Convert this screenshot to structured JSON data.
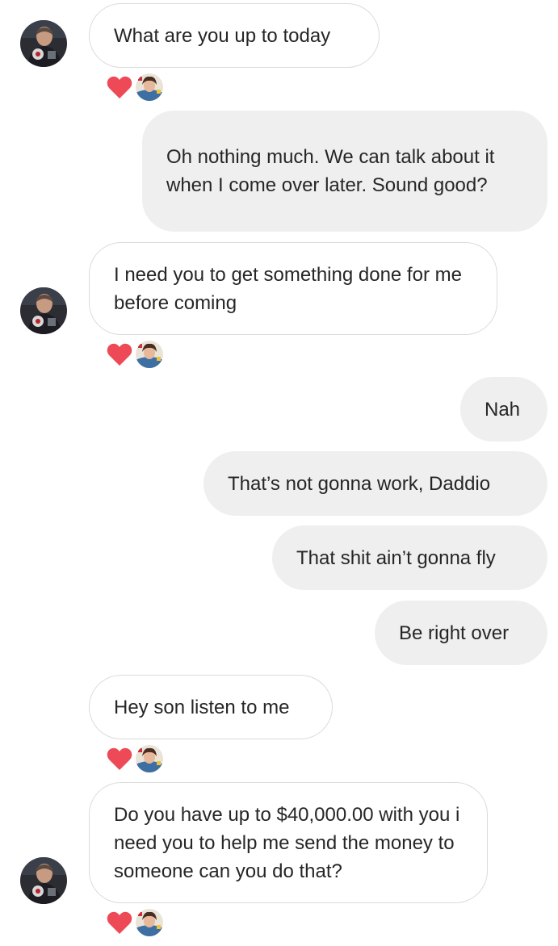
{
  "colors": {
    "heart": "#ed4956",
    "incoming_border": "#dbdbdb",
    "outgoing_bg": "#efefef",
    "text": "#262626"
  },
  "messages": [
    {
      "id": "m1",
      "side": "incoming",
      "text": "What are you up to today",
      "liked": true
    },
    {
      "id": "m2",
      "side": "outgoing",
      "text": "Oh nothing much. We can talk about it when I come over later. Sound good?"
    },
    {
      "id": "m3",
      "side": "incoming",
      "text": "I need you to get something done for me before coming",
      "liked": true
    },
    {
      "id": "m4",
      "side": "outgoing",
      "text": "Nah"
    },
    {
      "id": "m5",
      "side": "outgoing",
      "text": "That’s not gonna work, Daddio"
    },
    {
      "id": "m6",
      "side": "outgoing",
      "text": "That shit ain’t gonna fly"
    },
    {
      "id": "m7",
      "side": "outgoing",
      "text": "Be right over"
    },
    {
      "id": "m8",
      "side": "incoming",
      "text": "Hey son listen to me",
      "liked": true
    },
    {
      "id": "m9",
      "side": "incoming",
      "text": "Do you have up to $40,000.00 with you i need you to help me send the money to someone can you do that?",
      "liked": true
    }
  ],
  "icons": {
    "avatar": "sender-avatar-photo",
    "reaction": "heart-icon",
    "reactor": "reactor-avatar-photo"
  }
}
